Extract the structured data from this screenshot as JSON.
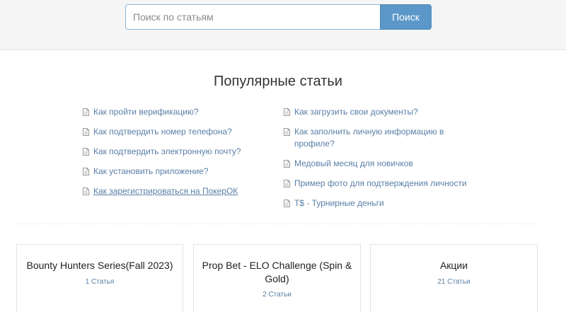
{
  "search": {
    "placeholder": "Поиск по статьям",
    "value": "",
    "button_label": "Поиск",
    "button_color": "#5b97c8"
  },
  "popular": {
    "title": "Популярные статьи",
    "icon": "document-icon",
    "left": [
      {
        "label": "Как пройти верификацию?"
      },
      {
        "label": "Как подтвердить номер телефона?"
      },
      {
        "label": "Как подтвердить электронную почту?"
      },
      {
        "label": "Как установить приложение?"
      },
      {
        "label": "Как зарегистрироваться на ПокерОК"
      }
    ],
    "right": [
      {
        "label": "Как загрузить свои документы?"
      },
      {
        "label": "Как заполнить личную информацию в профиле?"
      },
      {
        "label": "Медовый месяц для новичков"
      },
      {
        "label": "Пример фото для подтверждения личности"
      },
      {
        "label": "T$ - Турнирные деньги"
      }
    ],
    "link_color": "#5a7fa6"
  },
  "categories": [
    {
      "title": "Bounty Hunters Series(Fall 2023)",
      "count": "1 Статья"
    },
    {
      "title": "Prop Bet - ELO Challenge (Spin & Gold)",
      "count": "2 Статьи"
    },
    {
      "title": "Акции",
      "count": "21 Статьи"
    }
  ]
}
